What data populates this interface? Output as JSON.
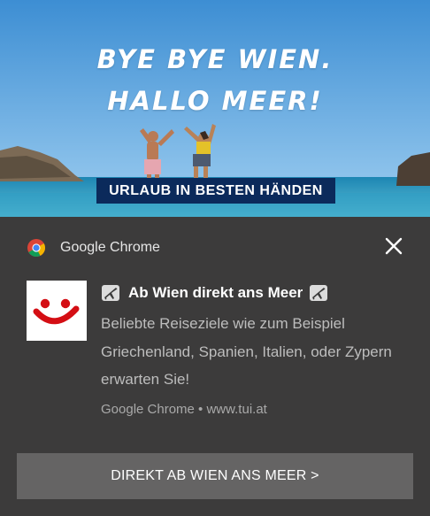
{
  "hero": {
    "line1": "BYE BYE WIEN.",
    "line2": "HALLO MEER!",
    "banner": "URLAUB IN BESTEN HÄNDEN"
  },
  "notification": {
    "app_name": "Google Chrome",
    "title": "Ab Wien direkt ans Meer",
    "body": "Beliebte Reiseziele wie zum Beispiel Griechenland, Spanien, Italien, oder Zypern erwarten Sie!",
    "source": "Google Chrome • www.tui.at",
    "action_label": "DIREKT AB WIEN ANS MEER >",
    "icons": {
      "app": "chrome-icon",
      "close": "close-icon",
      "brand": "tui-logo",
      "title_decoration": "airplane-icon"
    }
  },
  "colors": {
    "panel_bg": "#3c3b3b",
    "button_bg": "#656464",
    "banner_bg": "#0b2a5b",
    "tui_red": "#d40e14",
    "sky": "#4a9fd8",
    "sea": "#1f8fb7"
  }
}
